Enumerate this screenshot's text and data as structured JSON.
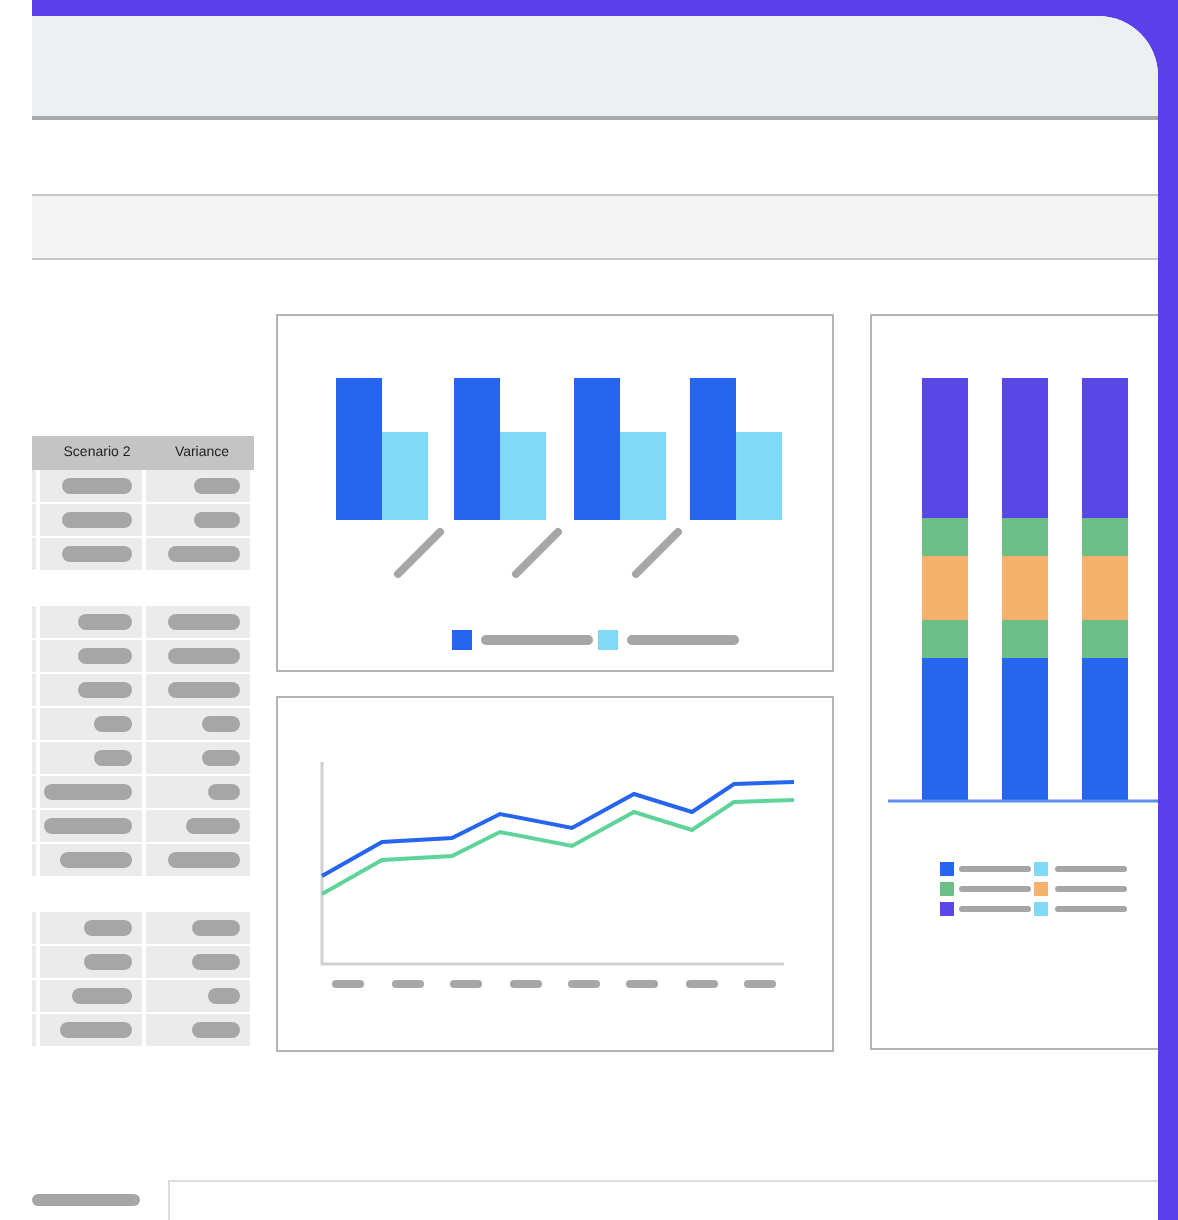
{
  "table": {
    "columns": [
      {
        "label": "Scenario 2"
      },
      {
        "label": "Variance"
      }
    ]
  }
}
